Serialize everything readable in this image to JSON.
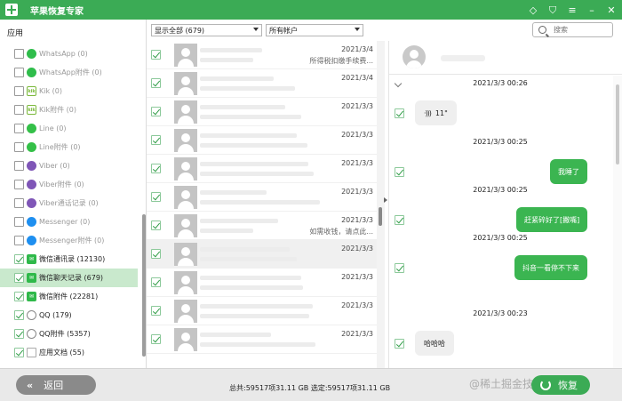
{
  "window": {
    "title": "苹果恢复专家",
    "controls": [
      "diamond-icon",
      "cart-icon",
      "menu-icon",
      "minimize-icon",
      "close-icon"
    ]
  },
  "sidebar": {
    "header": "应用",
    "items": [
      {
        "label": "WhatsApp (0)",
        "icon": "whatsapp-icon",
        "checked": false
      },
      {
        "label": "WhatsApp附件 (0)",
        "icon": "whatsapp-icon",
        "checked": false
      },
      {
        "label": "Kik (0)",
        "icon": "kik-icon",
        "checked": false
      },
      {
        "label": "Kik附件 (0)",
        "icon": "kik-icon",
        "checked": false
      },
      {
        "label": "Line (0)",
        "icon": "line-icon",
        "checked": false
      },
      {
        "label": "Line附件 (0)",
        "icon": "line-icon",
        "checked": false
      },
      {
        "label": "Viber (0)",
        "icon": "viber-icon",
        "checked": false
      },
      {
        "label": "Viber附件 (0)",
        "icon": "viber-icon",
        "checked": false
      },
      {
        "label": "Viber通话记录 (0)",
        "icon": "viber-icon",
        "checked": false
      },
      {
        "label": "Messenger (0)",
        "icon": "messenger-icon",
        "checked": false
      },
      {
        "label": "Messenger附件 (0)",
        "icon": "messenger-icon",
        "checked": false
      },
      {
        "label": "微信通讯录 (12130)",
        "icon": "wechat-icon",
        "checked": true
      },
      {
        "label": "微信聊天记录 (679)",
        "icon": "wechat-icon",
        "checked": true,
        "active": true
      },
      {
        "label": "微信附件 (22281)",
        "icon": "wechat-icon",
        "checked": true
      },
      {
        "label": "QQ (179)",
        "icon": "qq-icon",
        "checked": true
      },
      {
        "label": "QQ附件 (5357)",
        "icon": "qq-icon",
        "checked": true
      },
      {
        "label": "应用文档 (55)",
        "icon": "document-icon",
        "checked": true
      }
    ]
  },
  "filters": {
    "show": "显示全部 (679)",
    "account": "所有帐户",
    "search_placeholder": "搜索"
  },
  "chat_list": [
    {
      "time": "2021/3/4",
      "preview": "所得税扣缴手续费...",
      "checked": true
    },
    {
      "time": "2021/3/4",
      "preview": "",
      "checked": true
    },
    {
      "time": "2021/3/3",
      "preview": "",
      "checked": true
    },
    {
      "time": "2021/3/3",
      "preview": "",
      "checked": true
    },
    {
      "time": "2021/3/3",
      "preview": "",
      "checked": true
    },
    {
      "time": "2021/3/3",
      "preview": "",
      "checked": true
    },
    {
      "time": "2021/3/3",
      "preview": "如需收钱，请点此...",
      "checked": true
    },
    {
      "time": "2021/3/3",
      "preview": "",
      "checked": true,
      "selected": true
    },
    {
      "time": "2021/3/3",
      "preview": "",
      "checked": true
    },
    {
      "time": "2021/3/3",
      "preview": "",
      "checked": true
    },
    {
      "time": "2021/3/3",
      "preview": "",
      "checked": true
    }
  ],
  "conversation": {
    "messages": [
      {
        "time": "2021/3/3 00:26",
        "text": "11\"",
        "direction": "in",
        "type": "voice"
      },
      {
        "time": "2021/3/3 00:25",
        "text": "我睡了",
        "direction": "out"
      },
      {
        "time": "2021/3/3 00:25",
        "text": "赶紧碎好了[撇嘴]",
        "direction": "out"
      },
      {
        "time": "2021/3/3 00:25",
        "text": "抖音一看停不下来",
        "direction": "out"
      },
      {
        "time": "2021/3/3 00:23",
        "text": "哈哈哈",
        "direction": "in"
      }
    ]
  },
  "footer": {
    "back_label": "返回",
    "stats": "总共:59517项31.11 GB 选定:59517项31.11 GB",
    "recover_label": "恢复",
    "watermark": "@稀土掘金技术社区"
  },
  "colors": {
    "brand_green": "#3bab55",
    "bubble_out": "#3bb551",
    "active_row": "#c9e9cd"
  }
}
